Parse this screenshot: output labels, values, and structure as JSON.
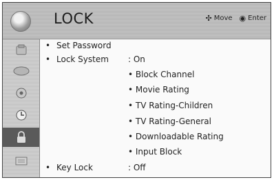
{
  "header": {
    "title": "LOCK",
    "hints": [
      {
        "icon": "dpad-icon",
        "glyph": "✣",
        "label": "Move"
      },
      {
        "icon": "ok-button-icon",
        "glyph": "◉",
        "label": "Enter"
      }
    ]
  },
  "sidebar": {
    "items": [
      {
        "name": "setup-icon",
        "selected": false
      },
      {
        "name": "picture-icon",
        "selected": false
      },
      {
        "name": "audio-icon",
        "selected": false
      },
      {
        "name": "time-icon",
        "selected": false
      },
      {
        "name": "lock-icon",
        "selected": true
      },
      {
        "name": "option-icon",
        "selected": false
      }
    ]
  },
  "menu": {
    "set_password": {
      "bullet": "•",
      "label": "Set Password"
    },
    "lock_system": {
      "bullet": "•",
      "label": "Lock System",
      "value": ": On",
      "subitems": [
        "• Block Channel",
        "• Movie Rating",
        "• TV Rating-Children",
        "• TV Rating-General",
        "• Downloadable Rating",
        "• Input Block"
      ]
    },
    "key_lock": {
      "bullet": "•",
      "label": "Key Lock",
      "value": ": Off"
    }
  }
}
